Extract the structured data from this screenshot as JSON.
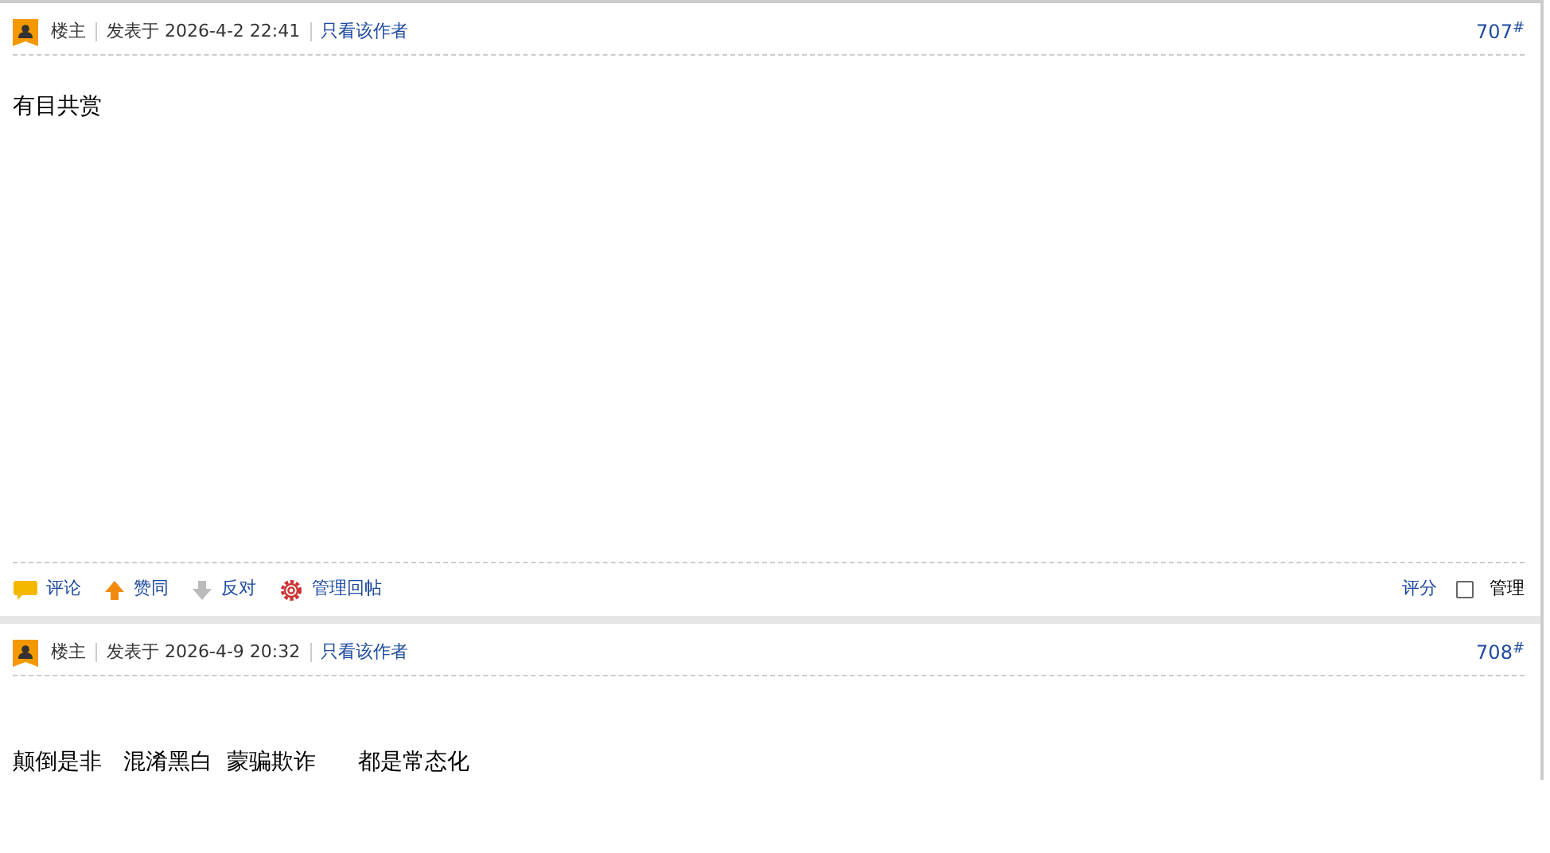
{
  "posts": [
    {
      "role": "楼主",
      "posted": "发表于 2026-4-2 22:41",
      "author_filter": "只看该作者",
      "floor": "707",
      "floor_mark": "#",
      "content": "有目共赏",
      "actions": [
        {
          "kind": "comment",
          "label": "评论"
        },
        {
          "kind": "up",
          "label": "赞同"
        },
        {
          "kind": "down",
          "label": "反对"
        },
        {
          "kind": "gear",
          "label": "管理回帖"
        }
      ],
      "rate": "评分",
      "manage": {
        "label": "管理",
        "checked": false
      }
    },
    {
      "role": "楼主",
      "posted": "发表于 2026-4-9 20:32",
      "author_filter": "只看该作者",
      "floor": "708",
      "floor_mark": "#",
      "content": "颠倒是非   混淆黑白  蒙骗欺诈      都是常态化"
    }
  ]
}
